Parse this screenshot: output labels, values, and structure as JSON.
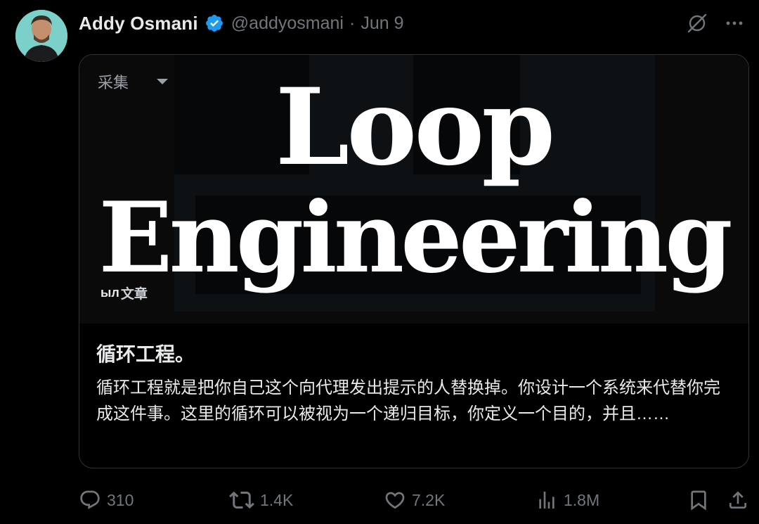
{
  "tweet": {
    "author_name": "Addy Osmani",
    "handle": "@addyosmani",
    "separator": "·",
    "date": "Jun 9"
  },
  "card": {
    "image_title_line1": "Loop",
    "image_title_line2": "Engineering",
    "overlay_label": "采集",
    "watermark_logo": "ыл",
    "watermark_text": "文章",
    "title": "循环工程。",
    "body": "循环工程就是把你自己这个向代理发出提示的人替换掉。你设计一个系统来代替你完成这件事。这里的循环可以被视为一个递归目标，你定义一个目的，并且……"
  },
  "actions": {
    "replies": "310",
    "reposts": "1.4K",
    "likes": "7.2K",
    "views": "1.8M"
  },
  "icons": {
    "verified": "verified-badge-icon",
    "grok": "grok-icon",
    "more": "more-icon",
    "reply": "reply-icon",
    "repost": "repost-icon",
    "like": "heart-icon",
    "views": "views-chart-icon",
    "bookmark": "bookmark-icon",
    "share": "share-icon"
  },
  "colors": {
    "background": "#000000",
    "text": "#e7e9ea",
    "muted": "#71767b",
    "verified": "#1d9bf0",
    "border": "#2f3336"
  }
}
